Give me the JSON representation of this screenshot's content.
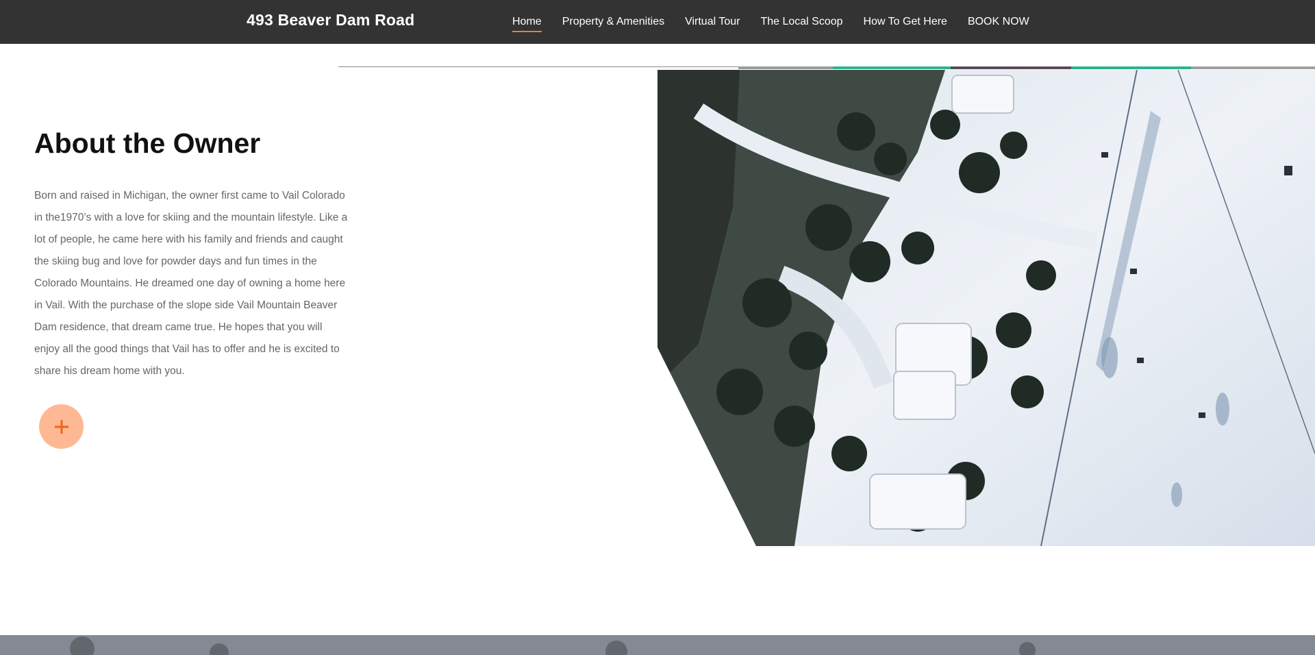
{
  "header": {
    "site_title": "493 Beaver Dam Road",
    "nav": [
      {
        "label": "Home",
        "active": true
      },
      {
        "label": "Property & Amenities",
        "active": false
      },
      {
        "label": "Virtual Tour",
        "active": false
      },
      {
        "label": "The Local Scoop",
        "active": false
      },
      {
        "label": "How To Get Here",
        "active": false
      },
      {
        "label": "BOOK NOW",
        "active": false
      }
    ]
  },
  "about": {
    "title": "About the Owner",
    "body": "Born and raised in Michigan, the owner first came to Vail Colorado in the1970’s with a love for skiing and the mountain lifestyle. Like a lot of people, he came here with his family and friends and caught the skiing bug and love for powder days and fun times in the Colorado Mountains. He dreamed one day of owning a home here in Vail.  With the purchase of the slope side Vail Mountain Beaver Dam residence, that dream came true. He hopes that you will enjoy all the good things that Vail has to offer and he is excited to share his dream home with you.",
    "expand_icon": "plus-icon"
  },
  "colors": {
    "header_bg": "#333333",
    "accent": "#f0802c",
    "plus_button": "#ffb894",
    "teal_accent": "#2bb38f"
  }
}
